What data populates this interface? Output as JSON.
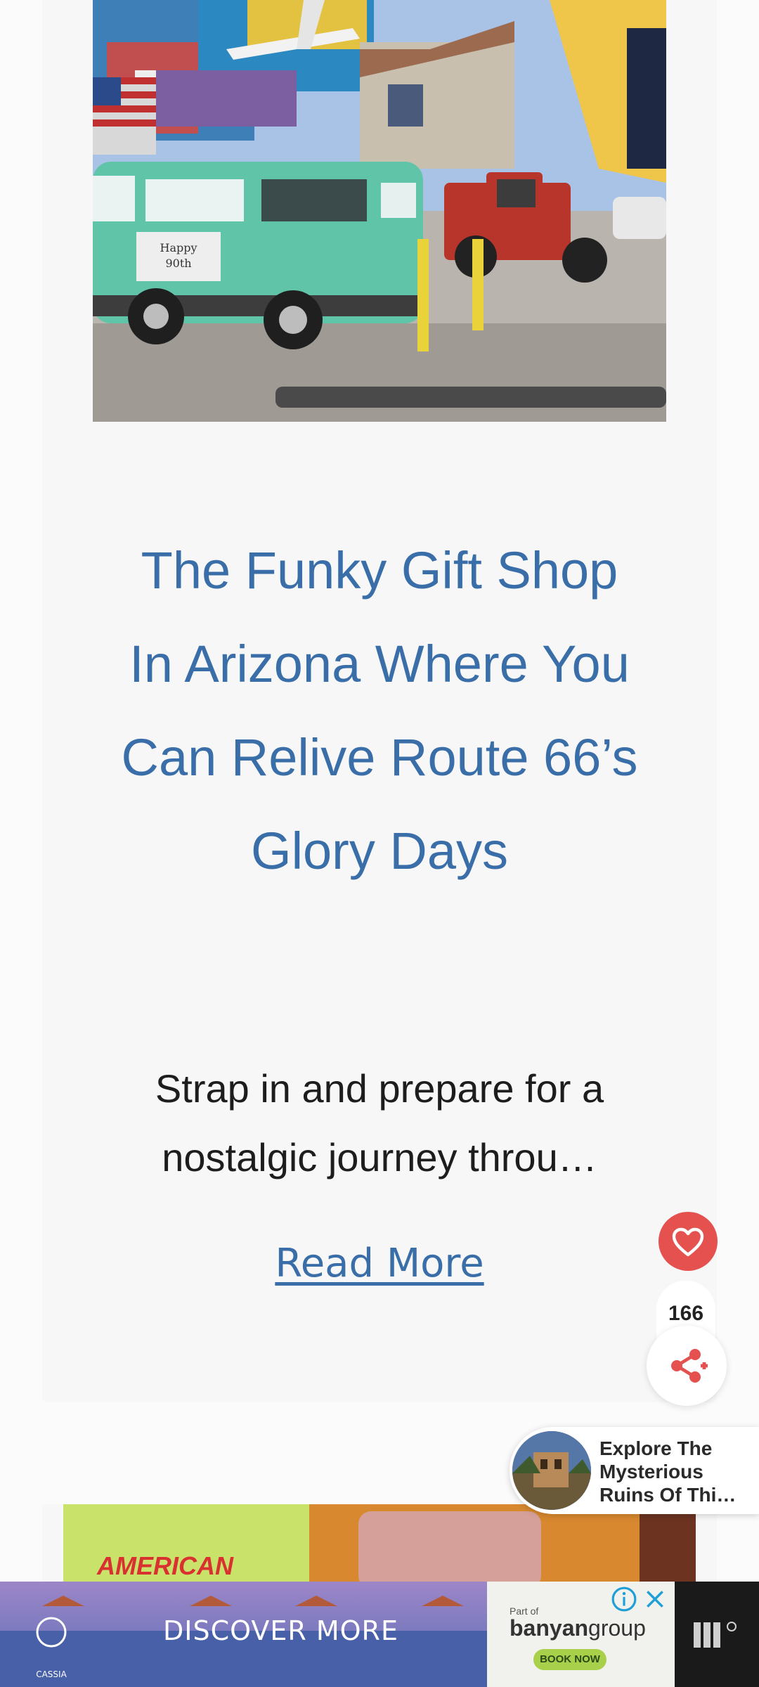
{
  "article": {
    "title": "The Funky Gift Shop In Arizona Where You Can Relive Route 66’s Glory Days",
    "excerpt": "Strap in and prepare for a nostalgic journey throu…",
    "read_more": "Read More",
    "hero_sign_text": "Happy 90th"
  },
  "share": {
    "count": "166",
    "heart_icon": "heart-icon",
    "share_icon": "share-icon"
  },
  "recommendation": {
    "title": "Explore The Mysterious Ruins Of Thi…",
    "line1": "Explore The",
    "line2": "Mysterious",
    "line3": "Ruins Of Thi…"
  },
  "next_card": {
    "image_text": "AMERICAN"
  },
  "ad": {
    "cta": "DISCOVER MORE",
    "advertiser_logo": "CASSIA",
    "part_of": "Part of",
    "brand_bold": "banyan",
    "brand_light": "group",
    "book_now": "BOOK NOW"
  },
  "colors": {
    "title_blue": "#3a6ea8",
    "heart_red": "#e4514f",
    "book_green": "#a8d04b"
  }
}
